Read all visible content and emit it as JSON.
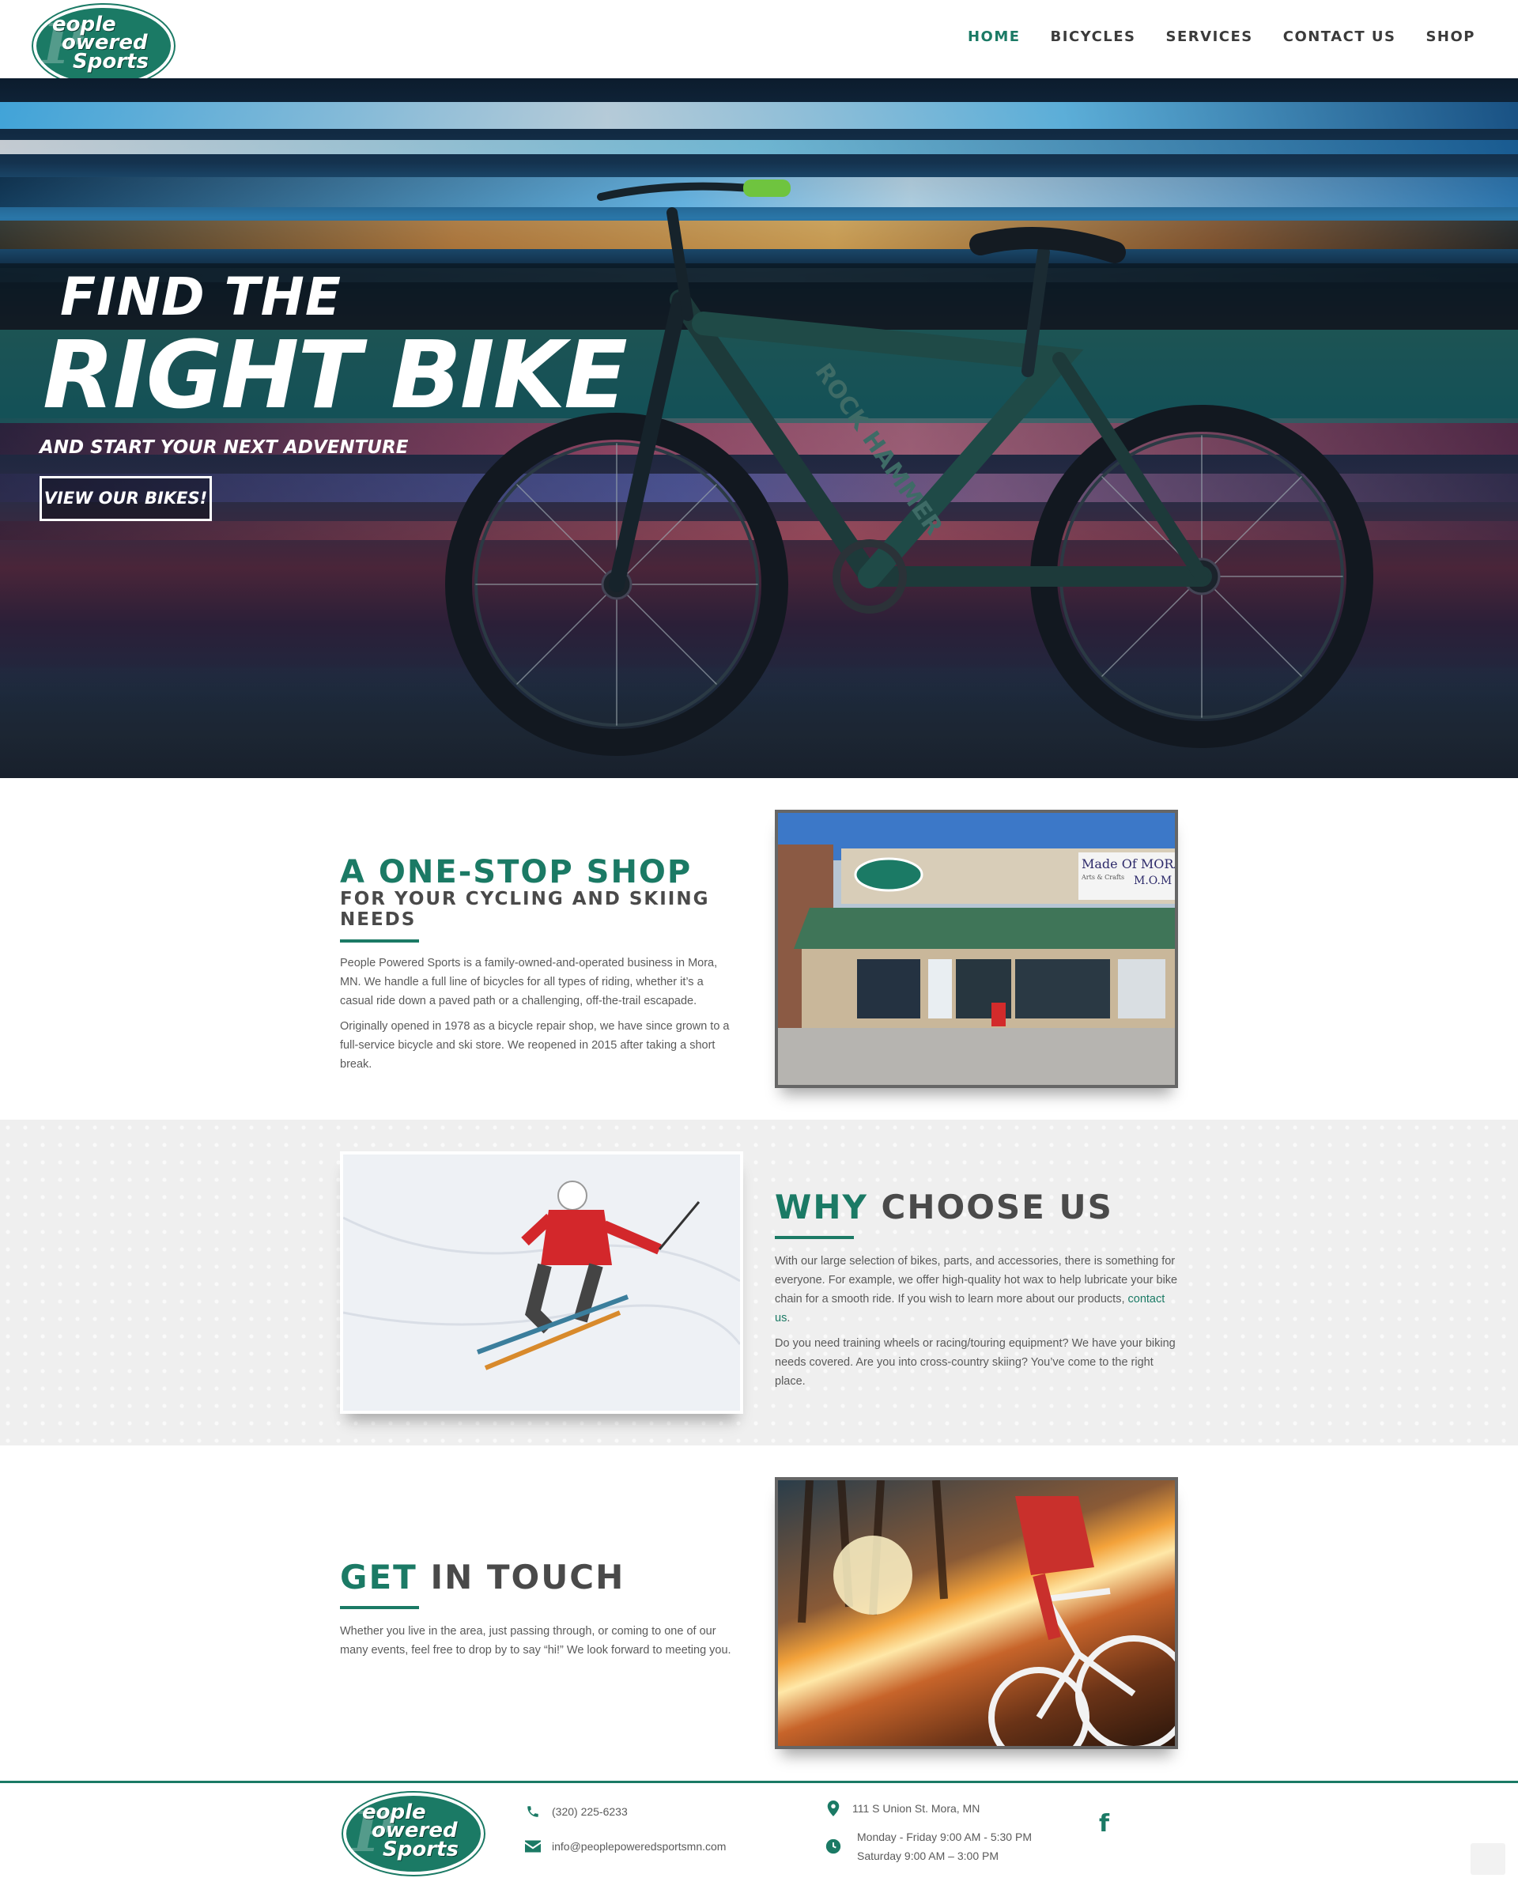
{
  "brand": {
    "logo_line1": "eople",
    "logo_line2": "owered",
    "logo_line3": "Sports",
    "logo_initial": "P"
  },
  "nav": [
    {
      "label": "HOME",
      "active": true
    },
    {
      "label": "BICYCLES",
      "active": false
    },
    {
      "label": "SERVICES",
      "active": false
    },
    {
      "label": "CONTACT US",
      "active": false
    },
    {
      "label": "SHOP",
      "active": false
    }
  ],
  "hero": {
    "line1": "FIND THE",
    "line2": "RIGHT BIKE",
    "line3": "AND START YOUR NEXT ADVENTURE",
    "button": "VIEW OUR BIKES!",
    "bike_brand_text": "ROCK HAMMER"
  },
  "shop": {
    "title": "A ONE-STOP SHOP",
    "subtitle": "FOR YOUR CYCLING AND SKIING NEEDS",
    "p1": "People Powered Sports is a family-owned-and-operated business in Mora, MN. We handle a full line of bicycles for all types of riding, whether it’s a casual ride down a paved path or a challenging, off-the-trail escapade.",
    "p2": "Originally opened in 1978 as a bicycle repair shop, we have since grown to a full-service bicycle and ski store. We reopened in 2015 after taking a short break.",
    "storefront_sign": "Made Of MORA",
    "storefront_sign2": "Arts & Crafts",
    "storefront_sign3": "M.O.M"
  },
  "why": {
    "title_a": "WHY",
    "title_b": "CHOOSE US",
    "p1_before": "With our large selection of bikes, parts, and accessories, there is something for everyone. For example, we offer high-quality hot wax to help lubricate your bike chain for a smooth ride. If you wish to learn more about our products,",
    "p1_link": "contact us",
    "p1_after": ".",
    "p2": "Do you need training wheels or racing/touring equipment? We have your biking needs covered. Are you into cross-country skiing? You’ve come to the right place."
  },
  "touch": {
    "title_a": "GET",
    "title_b": "IN TOUCH",
    "p1": "Whether you live in the area, just passing through, or coming to one of our many events, feel free to drop by to say “hi!” We look forward to meeting you."
  },
  "footer": {
    "phone": "(320) 225-6233",
    "email": "info@peoplepoweredsportsmn.com",
    "address": "111 S Union St. Mora, MN",
    "hours1": "Monday - Friday 9:00 AM - 5:30 PM",
    "hours2": "Saturday 9:00 AM – 3:00 PM",
    "facebook_glyph": "f"
  },
  "colors": {
    "brand_green": "#1b7a65",
    "text_dark": "#4a4a4a",
    "text_body": "#5a5a5a"
  }
}
